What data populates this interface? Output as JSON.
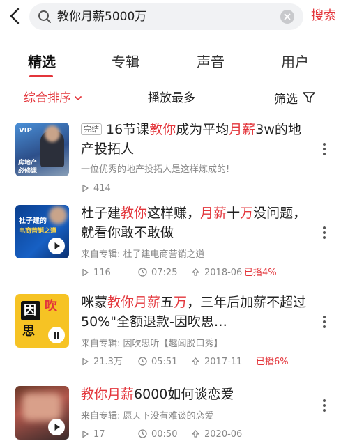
{
  "search": {
    "query": "教你月薪5000万",
    "button_label": "搜索"
  },
  "tabs": [
    {
      "label": "精选",
      "active": true
    },
    {
      "label": "专辑",
      "active": false
    },
    {
      "label": "声音",
      "active": false
    },
    {
      "label": "用户",
      "active": false
    }
  ],
  "filters": {
    "sort_label": "综合排序",
    "most_played_label": "播放最多",
    "filter_label": "筛选"
  },
  "results": [
    {
      "badge": "完结",
      "title_segments": [
        {
          "text": "16节课",
          "hl": false
        },
        {
          "text": "教你",
          "hl": true
        },
        {
          "text": "成为平均",
          "hl": false
        },
        {
          "text": "月薪",
          "hl": true
        },
        {
          "text": "3w的地产投拓人",
          "hl": false
        }
      ],
      "subtitle": "一位优秀的地产投拓人是这样炼成的!",
      "plays": "414",
      "thumb_texts": [
        "VIP",
        "房地产",
        "必修课"
      ]
    },
    {
      "title_segments": [
        {
          "text": "杜子建",
          "hl": false
        },
        {
          "text": "教你",
          "hl": true
        },
        {
          "text": "这样赚，",
          "hl": false
        },
        {
          "text": "月薪",
          "hl": true
        },
        {
          "text": "十",
          "hl": false
        },
        {
          "text": "万",
          "hl": true
        },
        {
          "text": "没问题，就看你敢不敢做",
          "hl": false
        }
      ],
      "subtitle": "来自专辑: 杜子建电商营销之道",
      "plays": "116",
      "duration": "07:25",
      "date": "2018-06",
      "played": "已播4%",
      "thumb_texts": [
        "杜子建的",
        "电商营销之道"
      ]
    },
    {
      "title_segments": [
        {
          "text": "咪蒙",
          "hl": false
        },
        {
          "text": "教你月薪",
          "hl": true
        },
        {
          "text": "五",
          "hl": false
        },
        {
          "text": "万",
          "hl": true
        },
        {
          "text": "，三年后加薪不超过50%\"全额退款-因吹思…",
          "hl": false
        }
      ],
      "subtitle": "来自专辑: 因吹思听【趣闻脱口秀】",
      "plays": "21.3万",
      "duration": "05:51",
      "date": "2017-11",
      "played": "已播6%",
      "thumb_texts": [
        "因",
        "思",
        "吹",
        "听"
      ]
    },
    {
      "title_segments": [
        {
          "text": "教你月薪",
          "hl": true
        },
        {
          "text": "6000如何谈恋爱",
          "hl": false
        }
      ],
      "subtitle": "来自专辑: 愿天下没有难谈的恋爱",
      "plays": "17",
      "duration": "00:50",
      "date": "2020-06"
    }
  ],
  "colors": {
    "accent": "#e3353b",
    "text": "#222222",
    "muted": "#888888"
  }
}
